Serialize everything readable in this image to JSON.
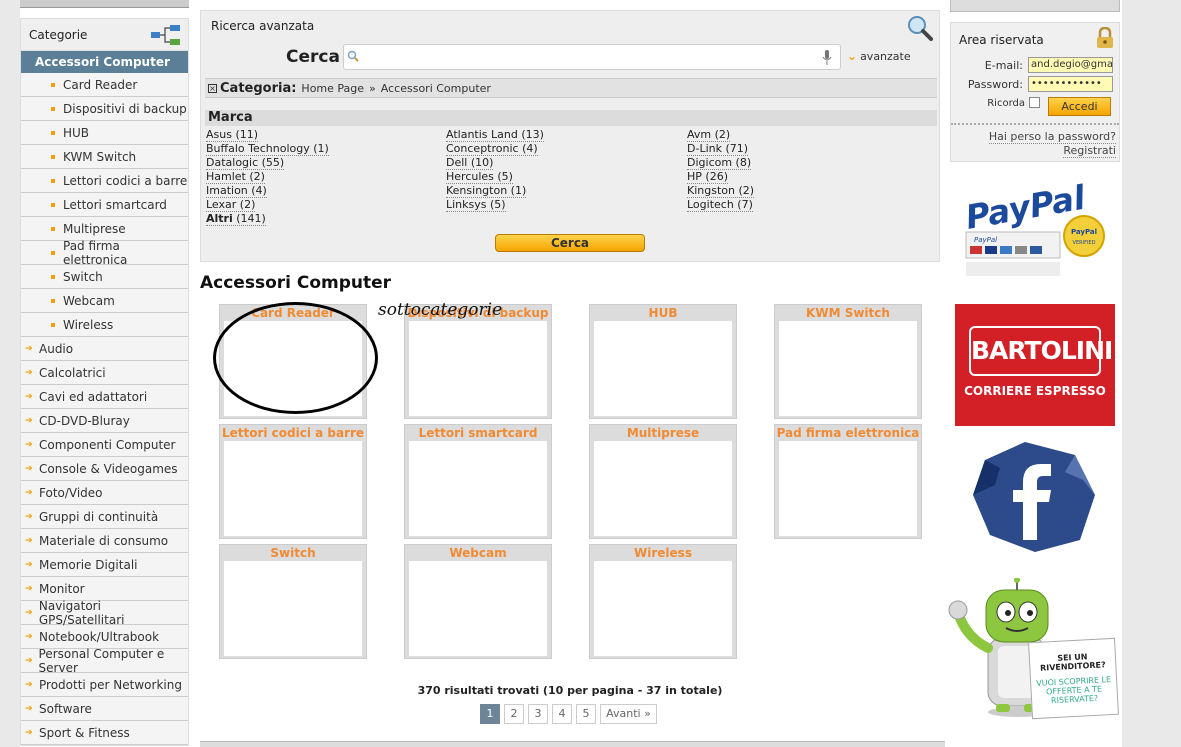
{
  "sidebar": {
    "title": "Categorie",
    "current": "Accessori Computer",
    "subitems": [
      "Card Reader",
      "Dispositivi di backup",
      "HUB",
      "KWM Switch",
      "Lettori codici a barre",
      "Lettori smartcard",
      "Multiprese",
      "Pad firma elettronica",
      "Switch",
      "Webcam",
      "Wireless"
    ],
    "categories": [
      "Audio",
      "Calcolatrici",
      "Cavi ed adattatori",
      "CD-DVD-Bluray",
      "Componenti Computer",
      "Console & Videogames",
      "Foto/Video",
      "Gruppi di continuità",
      "Materiale di consumo",
      "Memorie Digitali",
      "Monitor",
      "Navigatori GPS/Satellitari",
      "Notebook/Ultrabook",
      "Personal Computer e Server",
      "Prodotti per Networking",
      "Software",
      "Sport & Fitness"
    ]
  },
  "search": {
    "title": "Ricerca avanzata",
    "cerca_label": "Cerca",
    "input_value": "",
    "avanzate": "avanzate",
    "categoria_label": "Categoria:",
    "breadcrumb": [
      "Home Page",
      "Accessori Computer"
    ],
    "breadcrumb_sep": "»",
    "marca_label": "Marca",
    "brands": [
      [
        "Asus (11)",
        "Buffalo Technology (1)",
        "Datalogic (55)",
        "Hamlet (2)",
        "Imation (4)",
        "Lexar (2)"
      ],
      [
        "Atlantis Land (13)",
        "Conceptronic (4)",
        "Dell (10)",
        "Hercules (5)",
        "Kensington (1)",
        "Linksys (5)"
      ],
      [
        "Avm (2)",
        "D-Link (71)",
        "Digicom (8)",
        "HP (26)",
        "Kingston (2)",
        "Logitech (7)"
      ]
    ],
    "altri_label": "Altri",
    "altri_count": "(141)",
    "button": "Cerca"
  },
  "main": {
    "title": "Accessori Computer",
    "annotation": "sottocategorie",
    "tiles": [
      "Card Reader",
      "Dispositivi di backup",
      "HUB",
      "KWM Switch",
      "Lettori codici a barre",
      "Lettori smartcard",
      "Multiprese",
      "Pad firma elettronica",
      "Switch",
      "Webcam",
      "Wireless"
    ],
    "results": "370 risultati trovati (10 per pagina - 37 in totale)",
    "pages": [
      "1",
      "2",
      "3",
      "4",
      "5"
    ],
    "next": "Avanti »"
  },
  "login": {
    "title": "Area riservata",
    "email_label": "E-mail:",
    "email_value": "and.degio@gmail",
    "password_label": "Password:",
    "password_value": "••••••••••••",
    "remember_label": "Ricorda",
    "button": "Accedi",
    "forgot": "Hai perso la password?",
    "register": "Registrati"
  },
  "banners": {
    "paypal": "PayPal",
    "paypal_sub": "PayPal",
    "paypal_seal": "PayPal VERIFIED",
    "bartolini": "BARTOLINI",
    "bartolini_sub": "CORRIERE ESPRESSO",
    "robot_q": "SEI UN RIVENDITORE?",
    "robot_text": "VUOI SCOPRIRE LE OFFERTE A TE RISERVATE?"
  },
  "colors": {
    "accent": "#f5a000",
    "sidebar_active": "#5a7f96",
    "tile_label": "#f08b33",
    "bartolini_red": "#d31f26"
  }
}
